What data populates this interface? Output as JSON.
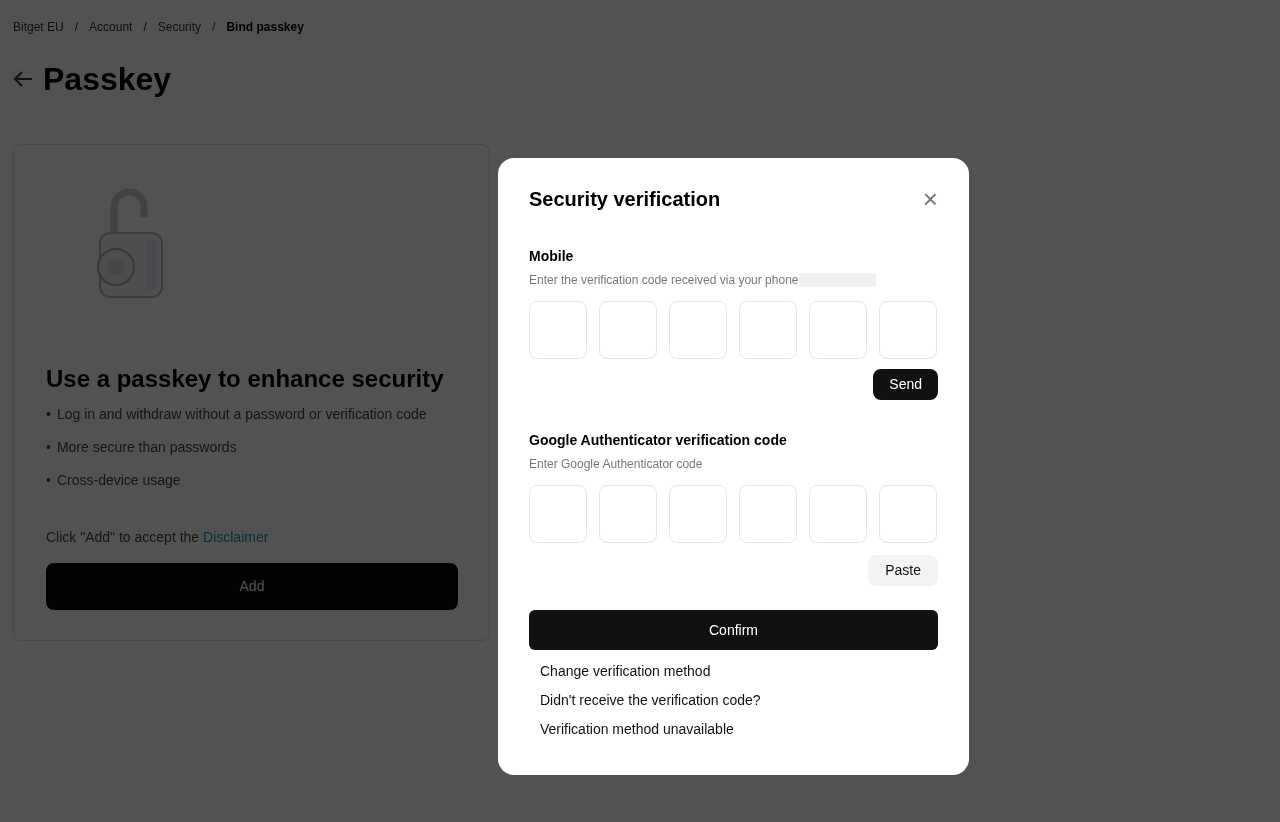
{
  "breadcrumb": [
    {
      "label": "Bitget EU",
      "current": false
    },
    {
      "label": "Account",
      "current": false
    },
    {
      "label": "Security",
      "current": false
    },
    {
      "label": "Bind passkey",
      "current": true
    }
  ],
  "breadcrumb_separator": "/",
  "page_title": "Passkey",
  "card": {
    "heading": "Use a passkey to enhance security",
    "bullet_marker": "•",
    "bullets": [
      "Log in and withdraw without a password or verification code",
      "More secure than passwords",
      "Cross-device usage"
    ],
    "disclaimer_text": "Click \"Add\" to accept the ",
    "disclaimer_link": "Disclaimer",
    "add_button": {
      "label": "Add",
      "disabled": true
    }
  },
  "dialog": {
    "title": "Security verification",
    "close": "×",
    "sections": [
      {
        "label": "Mobile",
        "hint": "Enter the verification code received via your phone",
        "redacted": true,
        "cells": [
          {
            "filled": false
          },
          {
            "filled": false
          },
          {
            "filled": false
          },
          {
            "filled": false
          },
          {
            "filled": false
          },
          {
            "filled": false
          }
        ],
        "action": {
          "kind": "dark",
          "label": "Send"
        }
      },
      {
        "label": "Google Authenticator verification code",
        "hint": "Enter Google Authenticator code",
        "cells": [
          {
            "filled": false
          },
          {
            "filled": false
          },
          {
            "filled": false
          },
          {
            "filled": false
          },
          {
            "filled": false
          },
          {
            "filled": false
          }
        ],
        "action": {
          "kind": "light",
          "label": "Paste"
        }
      }
    ],
    "confirm": "Confirm",
    "links": [
      "Change verification method",
      "Didn't receive the verification code?",
      "Verification method unavailable"
    ]
  }
}
